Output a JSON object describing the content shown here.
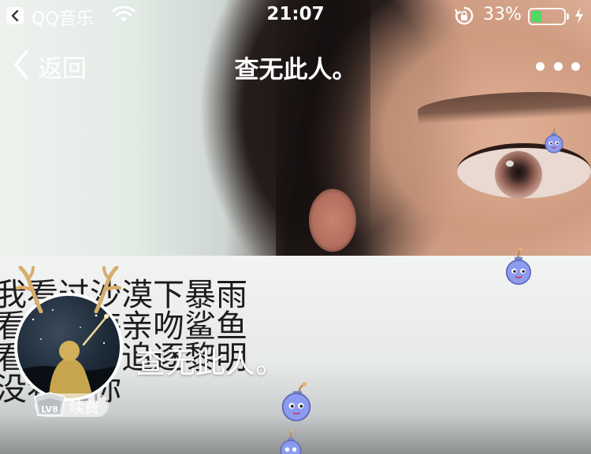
{
  "status_bar": {
    "back_app": "QQ音乐",
    "time": "21:07",
    "battery_text": "33%",
    "battery_level": 0.33,
    "battery_color": "#4cd964"
  },
  "nav": {
    "back_label": "返回",
    "title": "查无此人。",
    "more_icon": "ellipsis-icon"
  },
  "banner": {
    "lines": [
      "我看过沙漠下暴雨",
      "看过大海亲吻鲨鱼",
      "看过黄昏追逐黎明",
      "没看过你"
    ]
  },
  "profile": {
    "name": "查无此人。",
    "level_badge": "LV8",
    "renew_label": "续费"
  },
  "colors": {
    "text_on_photo": "#ffffff",
    "banner_text": "#1c1c1c",
    "bomb_body": "#8c9bf0"
  }
}
